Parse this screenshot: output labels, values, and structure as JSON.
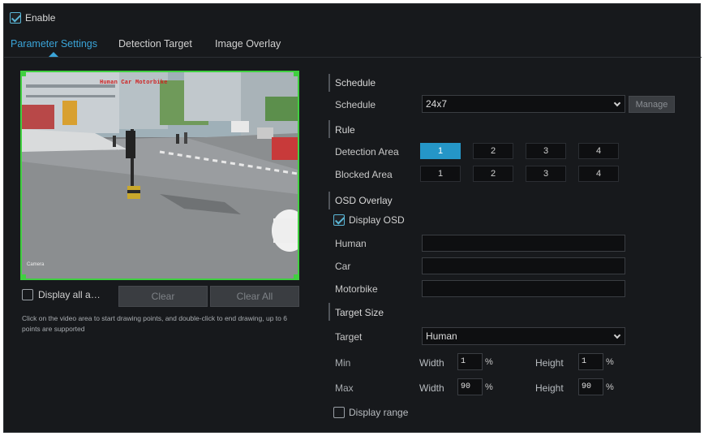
{
  "enable": {
    "label": "Enable",
    "checked": true
  },
  "tabs": [
    {
      "label": "Parameter Settings",
      "active": true
    },
    {
      "label": "Detection Target",
      "active": false
    },
    {
      "label": "Image Overlay",
      "active": false
    }
  ],
  "video": {
    "osd_alarm": "Human Car Motorbike",
    "camera_name": "Camera"
  },
  "left": {
    "display_all_label": "Display all a…",
    "clear_label": "Clear",
    "clear_all_label": "Clear All",
    "hint": "Click on the video area to start drawing points, and double-click to end drawing, up to 6 points are supported"
  },
  "schedule": {
    "section_title": "Schedule",
    "label": "Schedule",
    "value": "24x7",
    "manage_label": "Manage"
  },
  "rule": {
    "section_title": "Rule",
    "detection_area_label": "Detection Area",
    "blocked_area_label": "Blocked Area",
    "detection_areas": [
      "1",
      "2",
      "3",
      "4"
    ],
    "blocked_areas": [
      "1",
      "2",
      "3",
      "4"
    ],
    "active_detection_area": "1"
  },
  "osd": {
    "section_title": "OSD Overlay",
    "display_osd_label": "Display OSD",
    "display_osd_checked": true,
    "human_label": "Human",
    "car_label": "Car",
    "motorbike_label": "Motorbike",
    "human_value": "",
    "car_value": "",
    "motorbike_value": ""
  },
  "target_size": {
    "section_title": "Target Size",
    "target_label": "Target",
    "target_value": "Human",
    "min_label": "Min",
    "max_label": "Max",
    "width_label": "Width",
    "height_label": "Height",
    "min_width": "1",
    "min_height": "1",
    "max_width": "90",
    "max_height": "90",
    "unit": "%",
    "display_range_label": "Display range",
    "display_range_checked": false
  },
  "colors": {
    "accent": "#2596c7",
    "tab_active": "#3aa4d8",
    "region_border": "#40d040",
    "panel_bg": "#17191c"
  }
}
